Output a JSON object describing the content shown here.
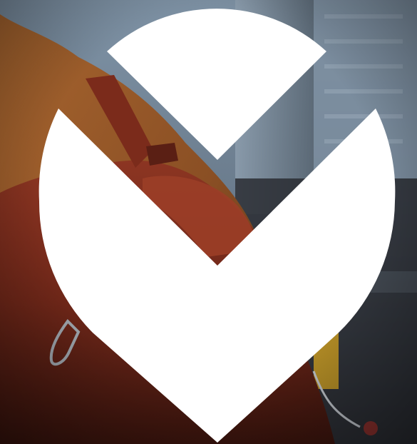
{
  "scene": {
    "subject": "backpacker-photo",
    "overlay_shape": "chevron-logo",
    "colors": {
      "logo": "#ffffff",
      "jacket": "#9a5a2a",
      "backpack": "#7a2c1c",
      "city_background": "#5f6f7e"
    }
  }
}
